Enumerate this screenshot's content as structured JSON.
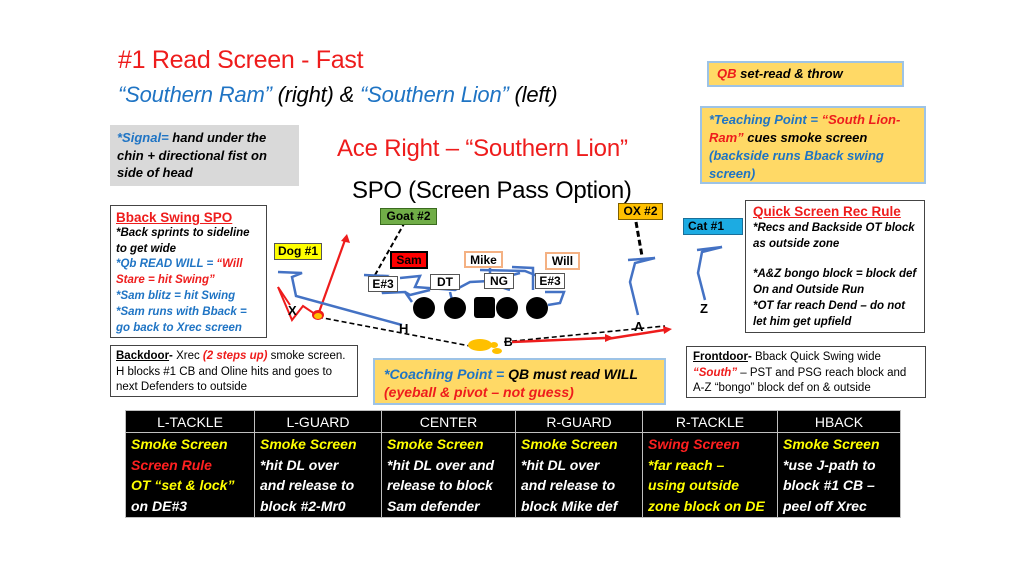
{
  "header": {
    "title": "#1 Read Screen - Fast",
    "subtitle": {
      "part1": "“Southern Ram”",
      "part2": " (right) & ",
      "part3": "“Southern Lion”",
      "part4": " (left)"
    }
  },
  "signal": {
    "label": "*Signal=",
    "text": " hand under the chin + directional fist on side of head"
  },
  "play": {
    "formation": "Ace Right – “Southern Lion”",
    "name": "SPO (Screen Pass Option)"
  },
  "qb_read": {
    "label": "QB",
    "text": " set-read & throw"
  },
  "teaching_point": {
    "label": "*Teaching Point = ",
    "call": "“South Lion-Ram”",
    "text": " cues smoke screen ",
    "note": "(backside runs Bback swing screen)"
  },
  "bback_swing": {
    "header": "Bback Swing SPO",
    "lines": [
      {
        "text": "*Back sprints to sideline to get wide",
        "color": "black"
      },
      {
        "text": "*Qb READ WILL = ",
        "color": "blue",
        "extra": "“Will Stare = hit Swing”"
      },
      {
        "text": "*Sam blitz = hit Swing",
        "color": "blue"
      },
      {
        "text": "*Sam runs with Bback = go back to Xrec screen",
        "color": "blue"
      }
    ]
  },
  "quick_screen": {
    "header": "Quick Screen Rec Rule",
    "lines": [
      "*Recs and Backside OT block as outside zone",
      "*A&Z bongo block = block def On and Outside Run",
      "*OT far reach Dend – do not let him get upfield"
    ]
  },
  "backdoor": {
    "label": "Backdoor",
    "dash": "- ",
    "text1": "Xrec ",
    "highlight": "(2 steps up)",
    "text2": " smoke screen.  H blocks #1 CB and Oline hits and goes to next Defenders to outside"
  },
  "frontdoor": {
    "label": "Frontdoor",
    "dash": "- ",
    "text1": "Bback Quick Swing wide ",
    "highlight": "“South”",
    "text2": " – PST and PSG reach block and A-Z “bongo” block def on & outside"
  },
  "coaching_point": {
    "label": "*Coaching Point = ",
    "text": "QB must read WILL ",
    "note": "(eyeball & pivot – not guess)"
  },
  "defenders": {
    "goat": "Goat #2",
    "ox": "OX #2",
    "dog": "Dog #1",
    "cat": "Cat #1",
    "sam": "Sam",
    "mike": "Mike",
    "will": "Will",
    "e3_left": "E#3",
    "dt": "DT",
    "ng": "NG",
    "e3_right": "E#3"
  },
  "offense": {
    "x": "X",
    "h": "H",
    "b": "B",
    "a": "A",
    "z": "Z"
  },
  "colors": {
    "red": "#ee1c1c",
    "blue": "#1f74c4",
    "route_blue": "#4472c4",
    "yellow_box": "#ffd966",
    "goat_green": "#70ad47",
    "ox_orange": "#ffc000",
    "cat_blue": "#1cabe2",
    "dog_yellow": "#ffff00",
    "lb_border": "#f4b183"
  },
  "assignments": {
    "headers": [
      "L-TACKLE",
      "L-GUARD",
      "CENTER",
      "R-GUARD",
      "R-TACKLE",
      "HBACK"
    ],
    "columns": [
      [
        {
          "t": "Smoke Screen",
          "c": "yellow"
        },
        {
          "t": "Screen Rule",
          "c": "red"
        },
        {
          "t": "OT “set & lock”",
          "c": "yellow"
        },
        {
          "t": "on DE#3",
          "c": "white"
        }
      ],
      [
        {
          "t": "Smoke Screen",
          "c": "yellow"
        },
        {
          "t": "*hit DL over",
          "c": "white"
        },
        {
          "t": "and release to",
          "c": "white"
        },
        {
          "t": "block #2-Mr0",
          "c": "white"
        }
      ],
      [
        {
          "t": "Smoke Screen",
          "c": "yellow"
        },
        {
          "t": "*hit DL over and",
          "c": "white"
        },
        {
          "t": "release to block",
          "c": "white"
        },
        {
          "t": "Sam defender",
          "c": "white"
        }
      ],
      [
        {
          "t": "Smoke Screen",
          "c": "yellow"
        },
        {
          "t": "*hit DL over",
          "c": "white"
        },
        {
          "t": "and release to",
          "c": "white"
        },
        {
          "t": "block Mike def",
          "c": "white"
        }
      ],
      [
        {
          "t": "Swing Screen",
          "c": "red"
        },
        {
          "t": "*far reach –",
          "c": "yellow"
        },
        {
          "t": "using outside",
          "c": "yellow"
        },
        {
          "t": "zone block on DE",
          "c": "yellow"
        }
      ],
      [
        {
          "t": "Smoke Screen",
          "c": "yellow"
        },
        {
          "t": "*use J-path to",
          "c": "white"
        },
        {
          "t": "block #1 CB –",
          "c": "white"
        },
        {
          "t": "peel off Xrec",
          "c": "white"
        }
      ]
    ]
  }
}
